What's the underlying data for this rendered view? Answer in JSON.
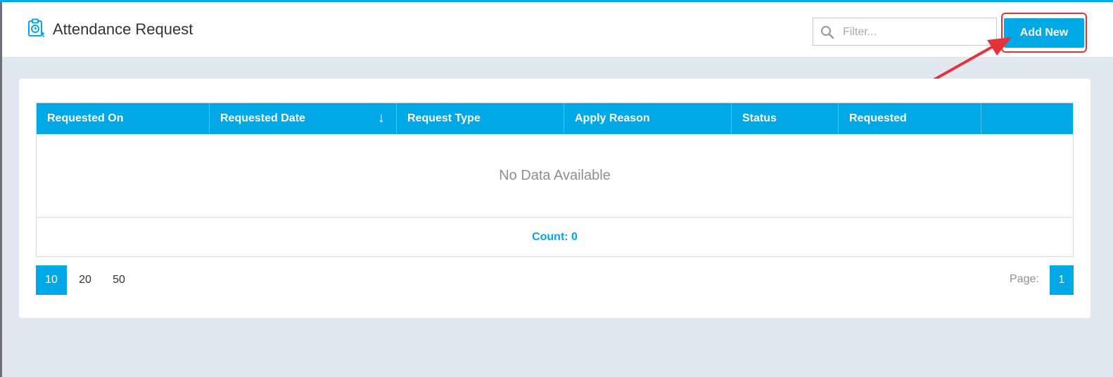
{
  "header": {
    "title": "Attendance Request",
    "filter_placeholder": "Filter...",
    "add_button": "Add New"
  },
  "table": {
    "columns": [
      "Requested On",
      "Requested Date",
      "Request Type",
      "Apply Reason",
      "Status",
      "Requested",
      ""
    ],
    "sorted_column": "Requested Date",
    "sort_direction": "descending",
    "sort_icon": "↓",
    "empty_message": "No Data Available",
    "count_text": "Count: 0"
  },
  "pagination": {
    "page_sizes": [
      "10",
      "20",
      "50"
    ],
    "active_page_size": "10",
    "page_label": "Page:",
    "current_page": "1"
  },
  "colors": {
    "accent": "#00a8e6",
    "highlight": "#e5323a"
  }
}
